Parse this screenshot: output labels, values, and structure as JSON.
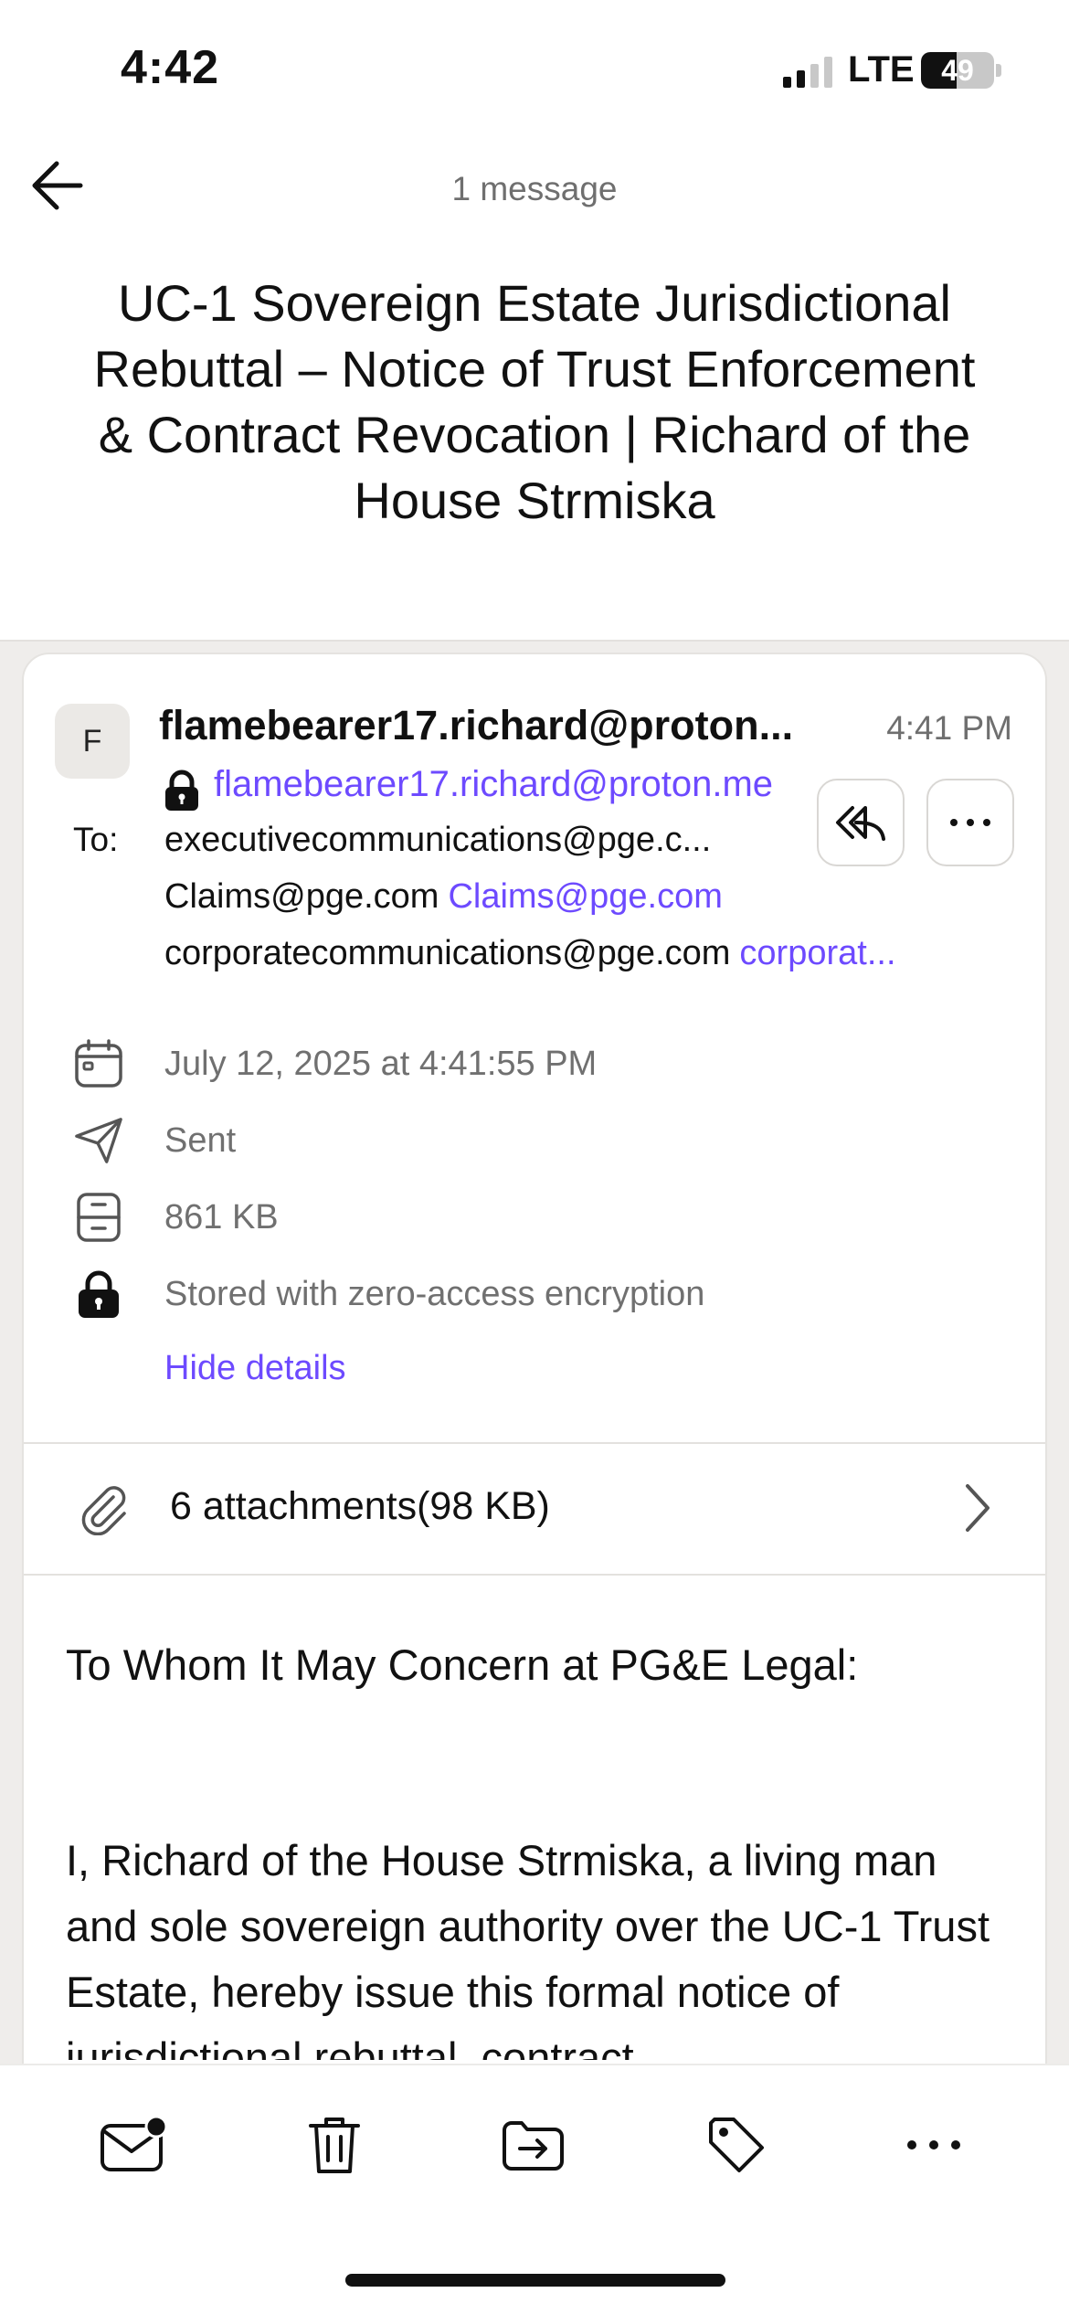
{
  "status_bar": {
    "time": "4:42",
    "network": "LTE",
    "battery": "49",
    "battery_level": 0.49
  },
  "header": {
    "message_count": "1 message"
  },
  "subject": "UC-1 Sovereign Estate Jurisdictional Rebuttal – Notice of Trust Enforcement & Contract Revocation | Richard of the House Strmiska",
  "sender": {
    "avatar_initial": "F",
    "display_name": "flamebearer17.richard@proton...",
    "time": "4:41 PM",
    "email": "flamebearer17.richard@proton.me"
  },
  "recipients": {
    "label": "To:",
    "items": [
      {
        "address": "executivecommunications@pge.c...",
        "name": ""
      },
      {
        "address": "Claims@pge.com",
        "name": "Claims@pge.com"
      },
      {
        "address": "corporatecommunications@pge.com",
        "name": "corporat..."
      }
    ]
  },
  "details": {
    "date": "July 12, 2025 at 4:41:55 PM",
    "folder": "Sent",
    "size": "861 KB",
    "encryption": "Stored with zero-access encryption",
    "hide_label": "Hide details"
  },
  "attachments": {
    "label": "6 attachments(98 KB)"
  },
  "body": {
    "greeting": "To Whom It May Concern at PG&E Legal:",
    "paragraph": "I, Richard of the House Strmiska, a living man and sole sovereign authority over the UC-1 Trust Estate, hereby issue this formal notice of jurisdictional rebuttal, contract"
  },
  "toolbar": {
    "items": [
      "mark-unread-icon",
      "trash-icon",
      "move-icon",
      "label-icon",
      "more-icon"
    ]
  },
  "colors": {
    "accent": "#6d4aff",
    "muted": "#6f6f6f",
    "background": "#efedeb"
  }
}
